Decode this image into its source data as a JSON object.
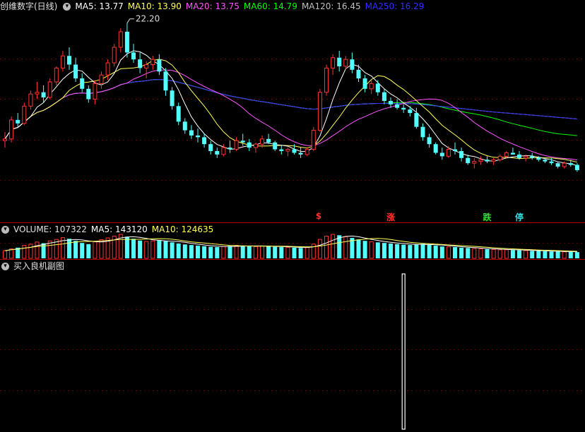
{
  "main_header": {
    "title": "创维数字(日线)",
    "ma5": "MA5: 13.77",
    "ma10": "MA10: 13.90",
    "ma20": "MA20: 13.75",
    "ma60": "MA60: 14.79",
    "ma120": "MA120: 16.45",
    "ma250": "MA250: 16.29"
  },
  "volume_header": {
    "volume": "VOLUME: 107322",
    "ma5": "MA5: 143120",
    "ma10": "MA10: 124635"
  },
  "sub_header": {
    "title": "买入良机副图"
  },
  "high_label": "22.20",
  "signals": [
    {
      "text": "$",
      "color": "#ff3333",
      "index": 49
    },
    {
      "text": "涨",
      "color": "#ff3333",
      "index": 60
    },
    {
      "text": "跌",
      "color": "#33dd33",
      "index": 75
    },
    {
      "text": "停",
      "color": "#33dddd",
      "index": 80
    }
  ],
  "colors": {
    "up": "#ff3333",
    "down": "#54ffff",
    "ma5": "#ffffff",
    "ma10": "#ffff54",
    "ma20": "#ff54ff",
    "ma60": "#00ff00",
    "ma120": "#c0c0c0",
    "ma250": "#3030ff"
  },
  "chart_data": {
    "type": "candlestick",
    "ylim": [
      10.8,
      22.8
    ],
    "candles": [
      [
        15.4,
        15.9,
        15.0,
        15.5
      ],
      [
        15.5,
        16.8,
        15.3,
        16.6
      ],
      [
        16.6,
        17.0,
        16.2,
        16.4
      ],
      [
        16.4,
        17.6,
        16.3,
        17.4
      ],
      [
        17.4,
        18.3,
        17.2,
        18.1
      ],
      [
        18.1,
        18.8,
        17.8,
        18.2
      ],
      [
        18.2,
        18.6,
        17.6,
        17.9
      ],
      [
        17.9,
        19.0,
        17.8,
        18.8
      ],
      [
        18.8,
        19.7,
        18.6,
        19.6
      ],
      [
        19.6,
        20.6,
        19.4,
        20.3
      ],
      [
        20.3,
        20.8,
        19.5,
        19.8
      ],
      [
        19.8,
        20.2,
        18.8,
        19.0
      ],
      [
        19.0,
        19.3,
        18.2,
        18.4
      ],
      [
        18.4,
        18.6,
        17.6,
        17.8
      ],
      [
        17.8,
        18.9,
        17.5,
        18.7
      ],
      [
        18.7,
        19.4,
        18.4,
        19.2
      ],
      [
        19.2,
        20.1,
        18.9,
        19.9
      ],
      [
        19.9,
        21.0,
        19.7,
        20.8
      ],
      [
        20.8,
        21.9,
        20.5,
        21.7
      ],
      [
        21.7,
        22.2,
        20.2,
        20.5
      ],
      [
        20.5,
        21.0,
        19.9,
        20.1
      ],
      [
        20.1,
        20.5,
        19.3,
        19.6
      ],
      [
        19.6,
        20.0,
        19.0,
        19.8
      ],
      [
        19.8,
        20.3,
        19.5,
        20.1
      ],
      [
        20.1,
        20.4,
        19.2,
        19.4
      ],
      [
        19.4,
        19.6,
        18.0,
        18.3
      ],
      [
        18.3,
        18.5,
        17.2,
        17.4
      ],
      [
        17.4,
        17.6,
        16.3,
        16.5
      ],
      [
        16.5,
        16.7,
        15.8,
        16.0
      ],
      [
        16.0,
        16.3,
        15.5,
        15.7
      ],
      [
        15.7,
        16.1,
        15.3,
        15.6
      ],
      [
        15.6,
        15.8,
        15.0,
        15.2
      ],
      [
        15.2,
        15.4,
        14.6,
        14.8
      ],
      [
        14.8,
        15.0,
        14.4,
        14.6
      ],
      [
        14.6,
        15.2,
        14.5,
        15.0
      ],
      [
        15.0,
        15.4,
        14.7,
        14.9
      ],
      [
        14.9,
        15.6,
        14.8,
        15.4
      ],
      [
        15.4,
        15.8,
        15.1,
        15.3
      ],
      [
        15.3,
        15.5,
        14.8,
        15.0
      ],
      [
        15.0,
        15.3,
        14.7,
        15.2
      ],
      [
        15.2,
        15.7,
        15.0,
        15.5
      ],
      [
        15.5,
        15.8,
        15.2,
        15.3
      ],
      [
        15.3,
        15.4,
        14.8,
        14.9
      ],
      [
        14.9,
        15.1,
        14.6,
        14.8
      ],
      [
        14.8,
        15.0,
        14.5,
        14.9
      ],
      [
        14.9,
        15.2,
        14.6,
        14.7
      ],
      [
        14.7,
        15.0,
        14.4,
        14.6
      ],
      [
        14.6,
        15.0,
        14.5,
        14.9
      ],
      [
        14.9,
        16.2,
        14.8,
        16.0
      ],
      [
        16.0,
        18.4,
        15.9,
        18.2
      ],
      [
        18.2,
        19.8,
        18.0,
        19.6
      ],
      [
        19.6,
        20.4,
        19.2,
        20.2
      ],
      [
        20.2,
        20.6,
        19.4,
        19.7
      ],
      [
        19.7,
        20.3,
        19.5,
        20.1
      ],
      [
        20.1,
        20.5,
        19.3,
        19.5
      ],
      [
        19.5,
        19.8,
        18.8,
        19.0
      ],
      [
        19.0,
        19.2,
        18.2,
        18.4
      ],
      [
        18.4,
        18.9,
        18.1,
        18.7
      ],
      [
        18.7,
        18.9,
        18.0,
        18.2
      ],
      [
        18.2,
        18.4,
        17.5,
        17.7
      ],
      [
        17.7,
        17.9,
        17.3,
        17.5
      ],
      [
        17.5,
        17.8,
        17.2,
        17.3
      ],
      [
        17.3,
        17.5,
        17.0,
        17.2
      ],
      [
        17.2,
        17.4,
        16.8,
        17.0
      ],
      [
        17.0,
        17.3,
        16.1,
        16.2
      ],
      [
        16.2,
        16.4,
        15.4,
        15.6
      ],
      [
        15.6,
        15.8,
        15.0,
        15.2
      ],
      [
        15.2,
        15.3,
        14.6,
        14.7
      ],
      [
        14.7,
        15.0,
        14.3,
        14.5
      ],
      [
        14.5,
        15.1,
        14.4,
        14.9
      ],
      [
        14.9,
        15.3,
        14.6,
        14.8
      ],
      [
        14.8,
        15.0,
        14.2,
        14.4
      ],
      [
        14.4,
        14.6,
        14.0,
        14.1
      ],
      [
        14.1,
        14.4,
        13.8,
        14.2
      ],
      [
        14.2,
        14.5,
        14.0,
        14.3
      ],
      [
        14.3,
        14.5,
        14.1,
        14.2
      ],
      [
        14.2,
        14.4,
        14.0,
        14.3
      ],
      [
        14.3,
        14.6,
        14.2,
        14.5
      ],
      [
        14.5,
        14.8,
        14.4,
        14.7
      ],
      [
        14.7,
        15.0,
        14.6,
        14.6
      ],
      [
        14.6,
        14.8,
        14.3,
        14.4
      ],
      [
        14.4,
        14.6,
        14.2,
        14.5
      ],
      [
        14.5,
        14.7,
        14.3,
        14.4
      ],
      [
        14.4,
        14.5,
        14.2,
        14.3
      ],
      [
        14.3,
        14.4,
        14.1,
        14.2
      ],
      [
        14.2,
        14.4,
        14.0,
        14.1
      ],
      [
        14.1,
        14.2,
        13.8,
        13.9
      ],
      [
        13.9,
        14.2,
        13.8,
        14.1
      ],
      [
        14.1,
        14.3,
        13.9,
        14.0
      ],
      [
        14.0,
        14.1,
        13.6,
        13.7
      ]
    ],
    "volume": [
      52,
      64,
      72,
      88,
      96,
      110,
      102,
      118,
      128,
      140,
      132,
      118,
      104,
      96,
      112,
      126,
      138,
      150,
      162,
      146,
      132,
      120,
      114,
      118,
      124,
      116,
      108,
      100,
      94,
      90,
      86,
      82,
      78,
      76,
      80,
      84,
      88,
      86,
      82,
      80,
      84,
      82,
      78,
      76,
      74,
      72,
      70,
      76,
      96,
      128,
      150,
      162,
      156,
      146,
      138,
      128,
      118,
      112,
      108,
      104,
      100,
      96,
      92,
      90,
      94,
      98,
      92,
      86,
      80,
      78,
      76,
      72,
      70,
      66,
      64,
      62,
      60,
      58,
      58,
      56,
      54,
      52,
      50,
      50,
      48,
      46,
      46,
      44,
      44,
      42
    ],
    "signal_bar": {
      "index": 62,
      "value": 1
    }
  }
}
